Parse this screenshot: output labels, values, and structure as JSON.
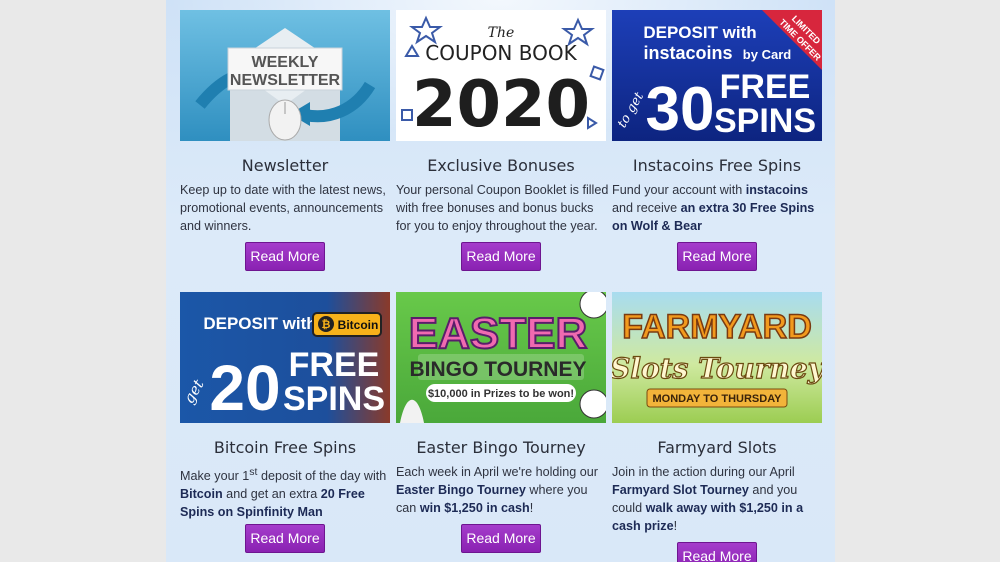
{
  "cards": [
    {
      "title": "Newsletter",
      "image_text": {
        "l1": "WEEKLY",
        "l2": "NEWSLETTER"
      },
      "desc": "Keep up to date with the latest news, promotional events, announcements and winners.",
      "button": "Read More"
    },
    {
      "title": "Exclusive Bonuses",
      "image_text": {
        "l1": "The",
        "l2": "COUPON BOOK",
        "l3": "2020"
      },
      "desc": "Your personal Coupon Booklet is filled with free bonuses and bonus bucks for you to enjoy throughout the year.",
      "button": "Read More"
    },
    {
      "title": "Instacoins Free Spins",
      "image_text": {
        "l1": "DEPOSIT with",
        "l2": "instacoins",
        "l3": "by Card",
        "l4": "to get",
        "l5": "30",
        "l6": "FREE",
        "l7": "SPINS",
        "ribbon1": "LIMITED",
        "ribbon2": "TIME OFFER"
      },
      "desc": {
        "a": "Fund your account with ",
        "b": "instacoins",
        "c": " and receive ",
        "d": "an extra 30 Free Spins on Wolf & Bear"
      },
      "button": "Read More"
    },
    {
      "title": "Bitcoin Free Spins",
      "image_text": {
        "l1": "DEPOSIT with",
        "l2": "Bitcoin",
        "l3": "get",
        "l4": "20",
        "l5": "FREE",
        "l6": "SPINS"
      },
      "desc": {
        "a": "Make your 1",
        "sup": "st",
        "b": " deposit of the day with ",
        "c": "Bitcoin",
        "d": " and get an extra ",
        "e": "20 Free Spins on Spinfinity Man"
      },
      "button": "Read More"
    },
    {
      "title": "Easter Bingo Tourney",
      "image_text": {
        "l1": "EASTER",
        "l2": "BINGO TOURNEY",
        "l3": "$10,000 in Prizes to be won!"
      },
      "desc": {
        "a": "Each week in April we're holding our ",
        "b": "Easter Bingo Tourney",
        "c": " where you can ",
        "d": "win $1,250 in cash",
        "e": "!"
      },
      "button": "Read More"
    },
    {
      "title": "Farmyard Slots",
      "image_text": {
        "l1": "FARMYARD",
        "l2": "Slots Tourney",
        "l3": "MONDAY TO THURSDAY"
      },
      "desc": {
        "a": "Join in the action during our April ",
        "b": "Farmyard Slot Tourney",
        "c": " and you could ",
        "d": "walk away with $1,250 in a cash prize",
        "e": "!"
      },
      "button": "Read More"
    }
  ],
  "colors": {
    "button": "#9a2fc2",
    "page_bg": "#d9e8f8",
    "title": "#2b2f3a"
  }
}
